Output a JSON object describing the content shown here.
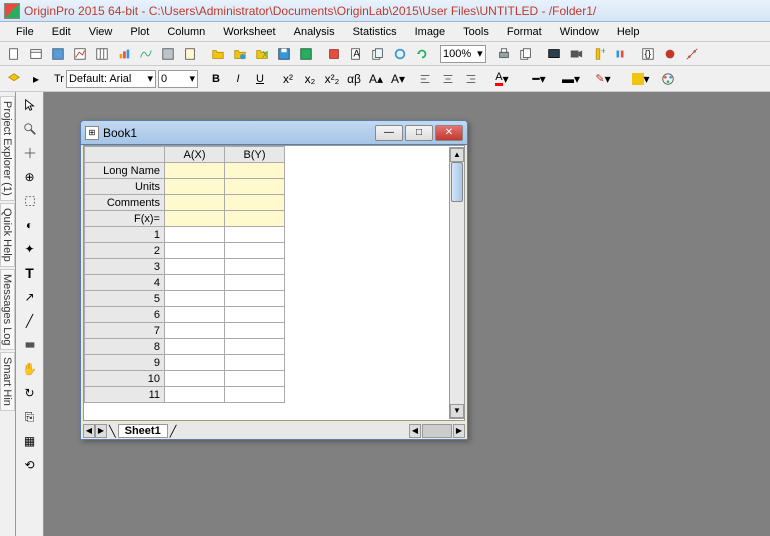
{
  "title": "OriginPro 2015 64-bit - C:\\Users\\Administrator\\Documents\\OriginLab\\2015\\User Files\\UNTITLED - /Folder1/",
  "menu": {
    "file": "File",
    "edit": "Edit",
    "view": "View",
    "plot": "Plot",
    "column": "Column",
    "worksheet": "Worksheet",
    "analysis": "Analysis",
    "statistics": "Statistics",
    "image": "Image",
    "tools": "Tools",
    "format": "Format",
    "window": "Window",
    "help": "Help"
  },
  "toolbar": {
    "zoom": "100%",
    "font": "Default: Arial",
    "fontsize": "0"
  },
  "book": {
    "title": "Book1",
    "columns": {
      "a": "A(X)",
      "b": "B(Y)"
    },
    "rowlabels": {
      "longname": "Long Name",
      "units": "Units",
      "comments": "Comments",
      "fx": "F(x)="
    },
    "rows": [
      "1",
      "2",
      "3",
      "4",
      "5",
      "6",
      "7",
      "8",
      "9",
      "10",
      "11"
    ],
    "sheet": "Sheet1"
  },
  "sidetabs": {
    "pe": "Project Explorer (1)",
    "qh": "Quick Help",
    "ml": "Messages Log",
    "sh": "Smart Hin"
  }
}
